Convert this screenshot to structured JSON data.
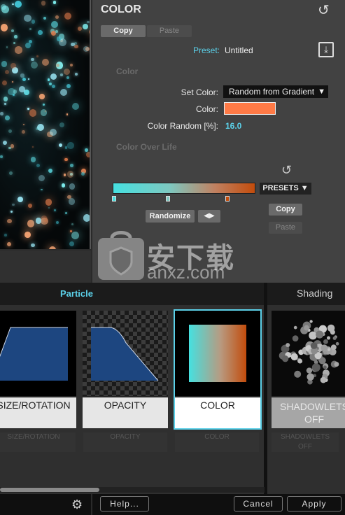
{
  "panel": {
    "title": "COLOR",
    "tabs": {
      "copy": "Copy",
      "paste": "Paste"
    },
    "preset_label": "Preset:",
    "preset_value": "Untitled",
    "section_color": "Color",
    "set_color_label": "Set Color:",
    "set_color_value": "Random from Gradient",
    "color_label": "Color:",
    "color_value": "#ff7a46",
    "color_random_label": "Color Random [%]:",
    "color_random_value": "16.0",
    "section_color_over_life": "Color Over Life",
    "presets_button": "PRESETS",
    "randomize_button": "Randomize",
    "copy_button": "Copy",
    "paste_button": "Paste"
  },
  "watermark": {
    "cn": "安下载",
    "url": "anxz.com"
  },
  "modules": {
    "tab_particle": "Particle",
    "tab_shading": "Shading",
    "cards": [
      {
        "label": "SIZE/ROTATION",
        "sub": "SIZE/ROTATION"
      },
      {
        "label": "OPACITY",
        "sub": "OPACITY"
      },
      {
        "label": "COLOR",
        "sub": "COLOR",
        "selected": true
      },
      {
        "label": "SHADOWLETS",
        "label2": "OFF",
        "sub": "SHADOWLETS",
        "sub2": "OFF"
      }
    ]
  },
  "footer": {
    "help": "Help...",
    "cancel": "Cancel",
    "apply": "Apply"
  },
  "icons": {
    "reset": "reset-icon",
    "save": "save-preset-icon",
    "gear": "gear-icon",
    "caret": "caret-down-icon"
  },
  "colors": {
    "accent": "#5bd0e8",
    "gradient_start": "#46e0e0",
    "gradient_end": "#c24c0c"
  }
}
